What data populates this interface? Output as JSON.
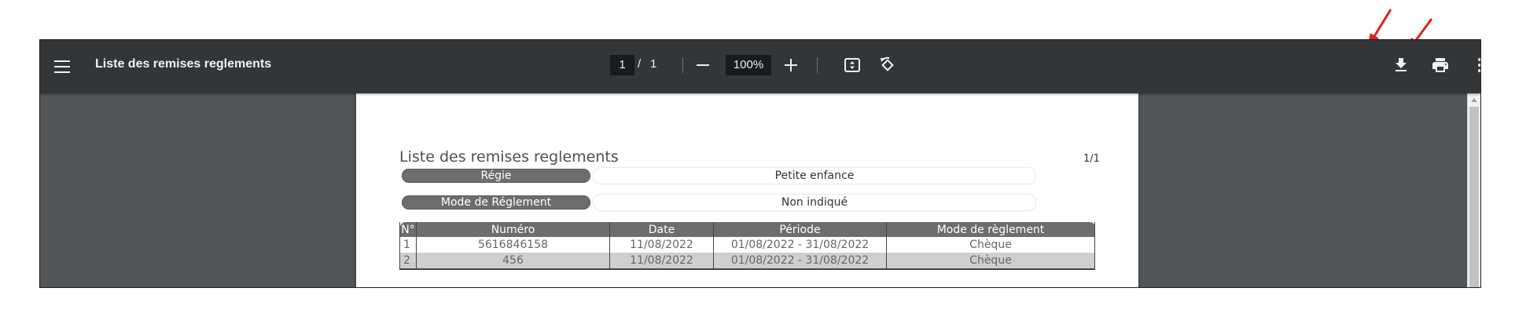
{
  "toolbar": {
    "title": "Liste des remises reglements",
    "current_page": "1",
    "page_separator": "/",
    "total_pages": "1",
    "zoom": "100%"
  },
  "icons": {
    "menu": "hamburger-menu-icon",
    "zoom_out": "minus-icon",
    "zoom_in": "plus-icon",
    "fit": "fit-to-page-icon",
    "rotate": "rotate-counterclockwise-icon",
    "download": "download-icon",
    "print": "print-icon",
    "more": "more-vertical-icon"
  },
  "colors": {
    "toolbar_bg": "#323639",
    "viewer_bg": "#525659",
    "label_bg": "#6d6d6d",
    "annotation_arrow": "#e02020"
  },
  "document": {
    "title": "Liste des remises reglements",
    "page_count": "1/1",
    "fields": [
      {
        "label": "Régie",
        "value": "Petite enfance"
      },
      {
        "label": "Mode de Réglement",
        "value": "Non indiqué"
      }
    ],
    "table": {
      "headers": [
        "N°",
        "Numéro",
        "Date",
        "Période",
        "Mode de règlement"
      ],
      "rows": [
        [
          "1",
          "5616846158",
          "11/08/2022",
          "01/08/2022 - 31/08/2022",
          "Chèque"
        ],
        [
          "2",
          "456",
          "11/08/2022",
          "01/08/2022 - 31/08/2022",
          "Chèque"
        ]
      ]
    }
  }
}
